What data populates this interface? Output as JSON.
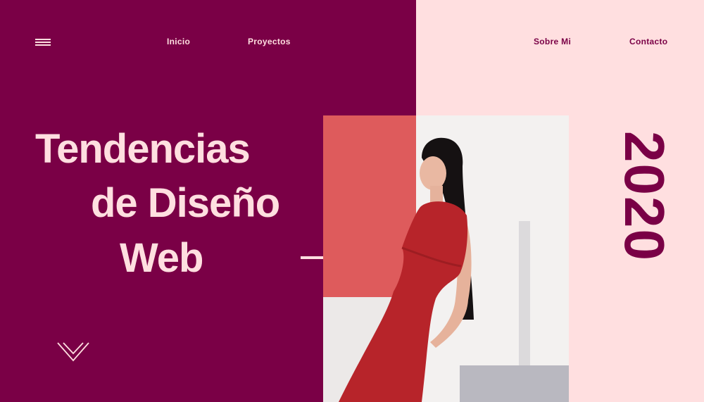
{
  "nav": {
    "menu_icon": "hamburger-icon",
    "items": [
      {
        "label": "Inicio"
      },
      {
        "label": "Proyectos"
      },
      {
        "label": "Sobre Mi"
      },
      {
        "label": "Contacto"
      }
    ]
  },
  "hero": {
    "title_lines": [
      "Tendencias",
      "de Diseño",
      "Web"
    ],
    "year": "2020",
    "scroll_icon": "chevron-down-icon",
    "image": "woman-in-red-dress-photo"
  },
  "colors": {
    "primary": "#7a0046",
    "light_pink": "#ffdfe0",
    "coral": "#de5b5c",
    "dress_red": "#b7242a"
  }
}
